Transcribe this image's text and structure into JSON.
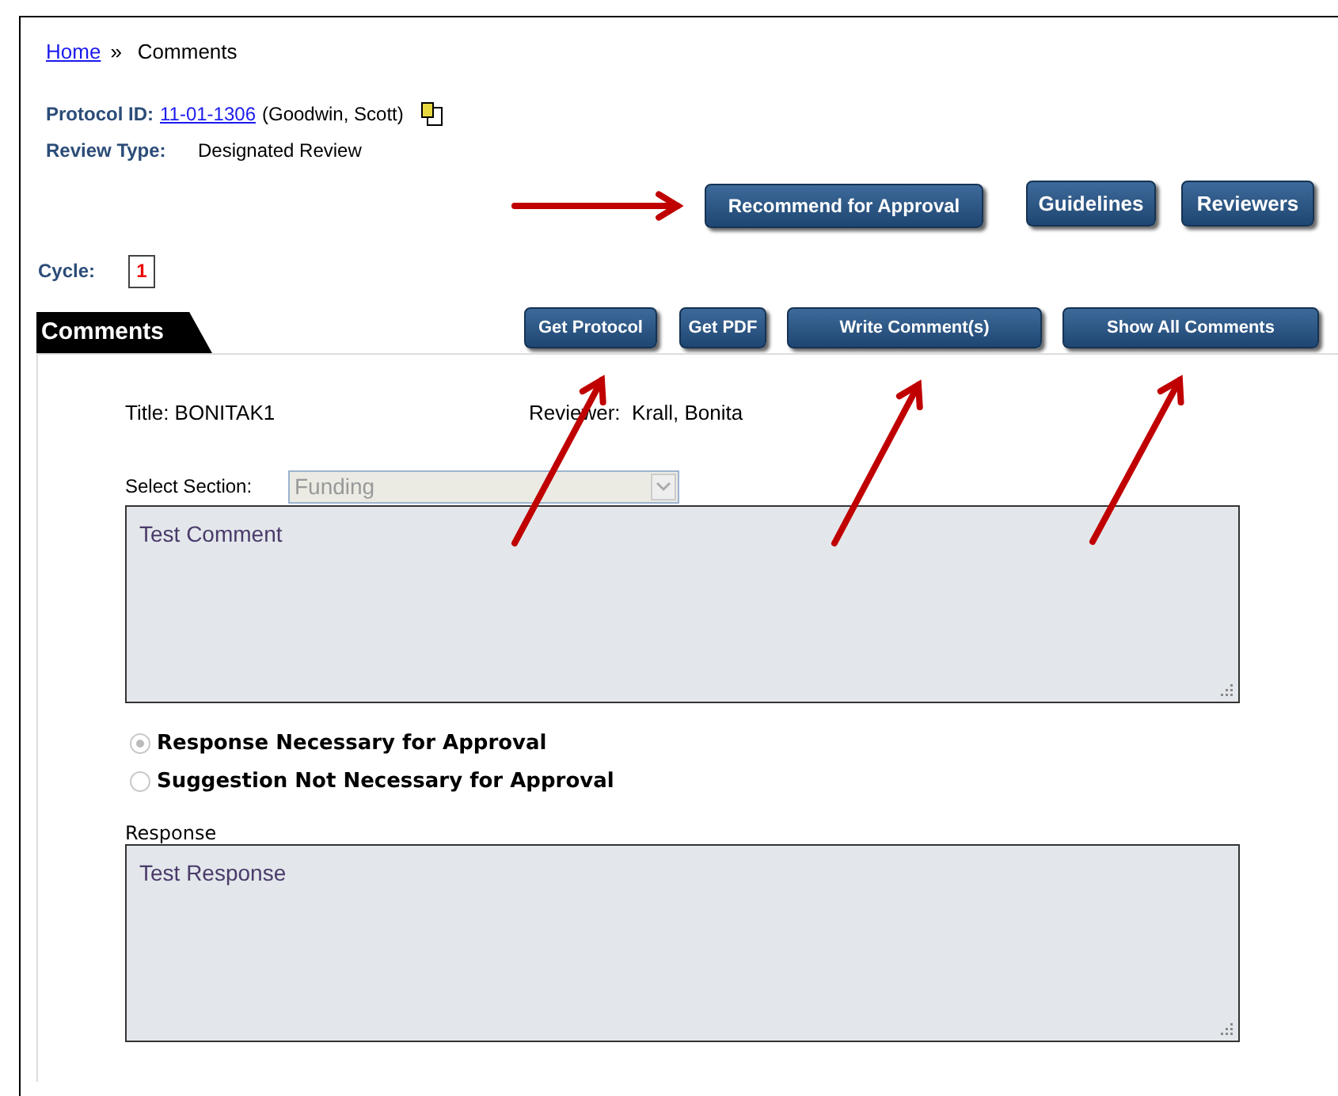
{
  "breadcrumb": {
    "link": "Home",
    "separator": "»",
    "current": "Comments"
  },
  "protocol": {
    "label": "Protocol ID:",
    "id": "11-01-1306",
    "person": "(Goodwin, Scott)"
  },
  "review_type": {
    "label": "Review Type:",
    "value": "Designated Review"
  },
  "top_buttons": [
    "Recommend for Approval",
    "Guidelines",
    "Reviewers"
  ],
  "cycle": {
    "label": "Cycle:",
    "number": "1"
  },
  "section_tab": "Comments",
  "section_buttons": [
    "Get Protocol",
    "Get PDF",
    "Write Comment(s)",
    "Show All Comments"
  ],
  "comment": {
    "title": "Title: BONITAK1",
    "reviewer": "Reviewer:  Krall, Bonita",
    "select_label": "Select Section:",
    "select_value": "Funding",
    "select_disabled": true,
    "text": "Test Comment"
  },
  "options": [
    {
      "label": "Response Necessary for Approval",
      "selected": true
    },
    {
      "label": "Suggestion Not Necessary for Approval",
      "selected": false
    }
  ],
  "response": {
    "label": "Response",
    "text": "Test Response"
  }
}
